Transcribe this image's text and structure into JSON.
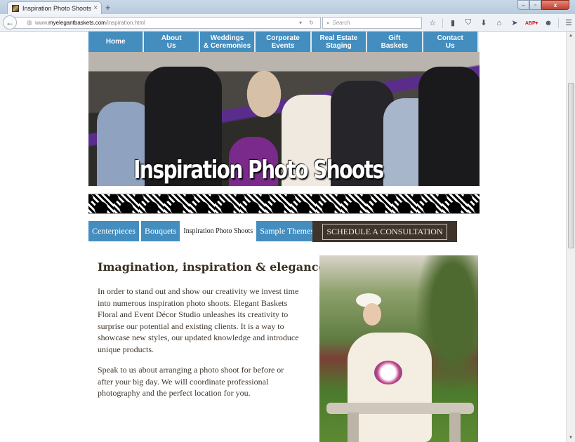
{
  "browser": {
    "tab_title": "Inspiration Photo Shoots",
    "tab_close": "×",
    "new_tab": "+",
    "url_prefix": "www.",
    "url_domain": "myelegantbaskets.com",
    "url_path": "/inspiration.html",
    "search_placeholder": "Search",
    "window_controls": {
      "minimize": "–",
      "restore": "▫",
      "close": "x"
    },
    "toolbar_icons": [
      "bookmark-star-icon",
      "clipboard-icon",
      "pocket-icon",
      "download-icon",
      "home-icon",
      "send-icon",
      "adblock-icon",
      "chat-icon",
      "menu-icon"
    ],
    "toolbar_glyphs": [
      "☆",
      "▮",
      "⛉",
      "⬇",
      "⌂",
      "➤",
      "ABP▾",
      "☻",
      "☰"
    ]
  },
  "main_nav": [
    {
      "label": "Home"
    },
    {
      "label": "About\nUs"
    },
    {
      "label": "Weddings\n& Ceremonies"
    },
    {
      "label": "Corporate\nEvents"
    },
    {
      "label": "Real Estate\nStaging"
    },
    {
      "label": "Gift\nBaskets"
    },
    {
      "label": "Contact\nUs"
    }
  ],
  "hero": {
    "title": "Inspiration Photo Shoots"
  },
  "sub_nav": [
    {
      "label": "Centerpieces",
      "active": false
    },
    {
      "label": "Bouquets",
      "active": false
    },
    {
      "label": "Inspiration Photo Shoots",
      "active": true
    },
    {
      "label": "Sample Themes",
      "active": false
    }
  ],
  "cta": {
    "label": "SCHEDULE A CONSULTATION"
  },
  "content": {
    "heading": "Imagination, inspiration & elegance",
    "paragraph1": "In order to stand out and show our creativity we invest time into numerous inspiration photo shoots. Elegant Baskets Floral and Event Décor Studio unleashes its creativity to surprise our potential and existing clients. It is a way to showcase new styles, our updated knowledge and introduce unique products.",
    "paragraph2": "Speak to us about arranging a photo shoot for before or after your big day. We will coordinate professional photography and the perfect location for you."
  },
  "colors": {
    "nav_blue": "#438dbf",
    "cta_brown": "#3e342b",
    "text_brown": "#3e352c"
  }
}
